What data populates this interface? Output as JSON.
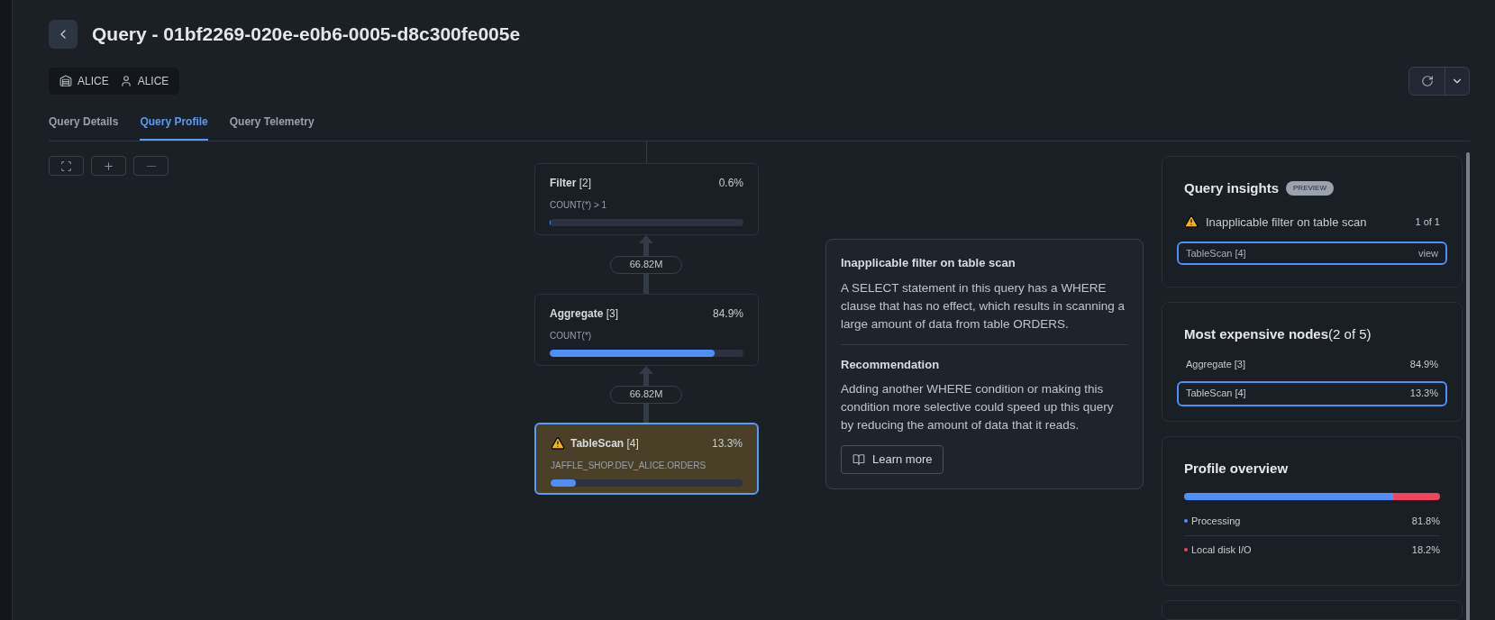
{
  "header": {
    "title": "Query - 01bf2269-020e-e0b6-0005-d8c300fe005e",
    "chips": [
      {
        "kind": "warehouse",
        "label": "ALICE"
      },
      {
        "kind": "user",
        "label": "ALICE"
      }
    ]
  },
  "tabs": [
    {
      "label": "Query Details",
      "selected": false
    },
    {
      "label": "Query Profile",
      "selected": true
    },
    {
      "label": "Query Telemetry",
      "selected": false
    }
  ],
  "graph": {
    "nodes": [
      {
        "name": "Filter",
        "index": "[2]",
        "percent": "0.6%",
        "detail": "COUNT(*) > 1",
        "level": 0.006,
        "warning": false,
        "selected": false
      },
      {
        "name": "Aggregate",
        "index": "[3]",
        "percent": "84.9%",
        "detail": "COUNT(*)",
        "level": 0.849,
        "warning": false,
        "selected": false
      },
      {
        "name": "TableScan",
        "index": "[4]",
        "percent": "13.3%",
        "detail": "JAFFLE_SHOP.DEV_ALICE.ORDERS",
        "level": 0.133,
        "warning": true,
        "selected": true
      }
    ],
    "edges": [
      {
        "label": "66.82M"
      },
      {
        "label": "66.82M"
      }
    ]
  },
  "tooltip": {
    "title": "Inapplicable filter on table scan",
    "body": "A SELECT statement in this query has a WHERE clause that has no effect, which results in scanning a large amount of data from table ORDERS.",
    "recommendation_title": "Recommendation",
    "recommendation": "Adding another WHERE condition or making this condition more selective could speed up this query by reducing the amount of data that it reads.",
    "button": "Learn more"
  },
  "insights": {
    "title": "Query insights",
    "badge": "PREVIEW",
    "items": [
      {
        "text": "Inapplicable filter on table scan",
        "count": "1 of 1"
      }
    ],
    "links": [
      {
        "label": "TableScan [4]",
        "action": "view",
        "selected": true
      }
    ]
  },
  "expensive": {
    "title": "Most expensive nodes",
    "count": "(2 of 5)",
    "rows": [
      {
        "label": "Aggregate [3]",
        "value": "84.9%",
        "selected": false
      },
      {
        "label": "TableScan [4]",
        "value": "13.3%",
        "selected": true
      }
    ]
  },
  "overview": {
    "title": "Profile overview",
    "items": [
      {
        "label": "Processing",
        "value": "81.8%",
        "level": 0.818,
        "color": "#4f8ff7"
      },
      {
        "label": "Local disk I/O",
        "value": "18.2%",
        "level": 0.182,
        "color": "#f0455f"
      }
    ]
  }
}
